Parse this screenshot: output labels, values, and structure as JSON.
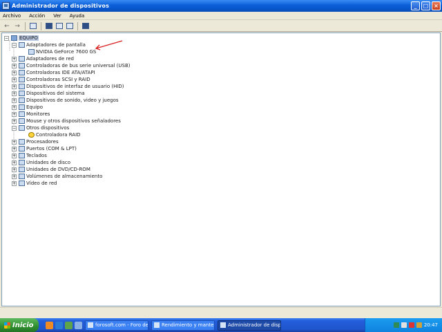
{
  "window": {
    "title": "Administrador de dispositivos"
  },
  "menubar": {
    "items": [
      "Archivo",
      "Acción",
      "Ver",
      "Ayuda"
    ]
  },
  "tree": {
    "root": "EQUIPO",
    "items": [
      {
        "label": "Adaptadores de pantalla",
        "expanded": true,
        "children": [
          "NVIDIA GeForce 7600 GS"
        ]
      },
      {
        "label": "Adaptadores de red"
      },
      {
        "label": "Controladoras de bus serie universal (USB)"
      },
      {
        "label": "Controladoras IDE ATA/ATAPI"
      },
      {
        "label": "Controladoras SCSI y RAID"
      },
      {
        "label": "Dispositivos de interfaz de usuario (HID)"
      },
      {
        "label": "Dispositivos del sistema"
      },
      {
        "label": "Dispositivos de sonido, video y juegos"
      },
      {
        "label": "Equipo"
      },
      {
        "label": "Monitores"
      },
      {
        "label": "Mouse y otros dispositivos señaladores"
      },
      {
        "label": "Otros dispositivos",
        "expanded": true,
        "warning": true,
        "children": [
          "Controladora RAID"
        ]
      },
      {
        "label": "Procesadores"
      },
      {
        "label": "Puertos (COM & LPT)"
      },
      {
        "label": "Teclados"
      },
      {
        "label": "Unidades de disco"
      },
      {
        "label": "Unidades de DVD/CD-ROM"
      },
      {
        "label": "Volúmenes de almacenamiento"
      },
      {
        "label": "Vídeo de red"
      }
    ]
  },
  "taskbar": {
    "start_label": "Inicio",
    "tasks": [
      "forosoft.com - Foro de ...",
      "Rendimiento y mante...",
      "Administrador de disp..."
    ],
    "clock": "20:47"
  },
  "colors": {
    "accent": "#0a5fd8",
    "annotation_arrow": "#d81e1e"
  }
}
